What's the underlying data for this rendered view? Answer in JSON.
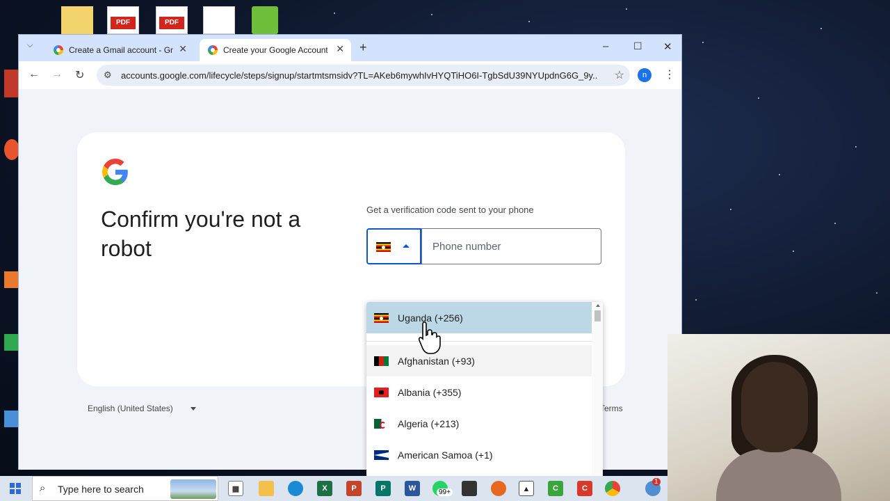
{
  "browser": {
    "tabs": [
      {
        "label": "Create a Gmail account - Gmail",
        "active": false
      },
      {
        "label": "Create your Google Account",
        "active": true
      }
    ],
    "url": "accounts.google.com/lifecycle/steps/signup/startmtsmsidv?TL=AKeb6mywhIvHYQTiHO6I-TgbSdU39NYUpdnG6G_9y...",
    "profile_initial": "n"
  },
  "page": {
    "heading": "Confirm you're not a robot",
    "subtext": "Get a verification code sent to your phone",
    "phone_placeholder": "Phone number",
    "selected_country_flag": "uganda-flag",
    "footer_language": "English (United States)",
    "footer_terms": "Terms"
  },
  "country_dropdown": {
    "selected": "Uganda (+256)",
    "options": [
      {
        "label": "Uganda (+256)",
        "flag": "uganda-flag"
      },
      {
        "label": "Afghanistan (+93)",
        "flag": "afghanistan-flag"
      },
      {
        "label": "Albania (+355)",
        "flag": "albania-flag"
      },
      {
        "label": "Algeria (+213)",
        "flag": "algeria-flag"
      },
      {
        "label": "American Samoa (+1)",
        "flag": "american-samoa-flag"
      }
    ]
  },
  "taskbar": {
    "search_text": "Type here to search",
    "whatsapp_badge": "99+",
    "notification_badge": "1"
  },
  "colors": {
    "tabstrip": "#d3e3fd",
    "page_bg": "#f0f4f9",
    "accent": "#0b57d0",
    "selected_option": "#bcd7e6"
  }
}
